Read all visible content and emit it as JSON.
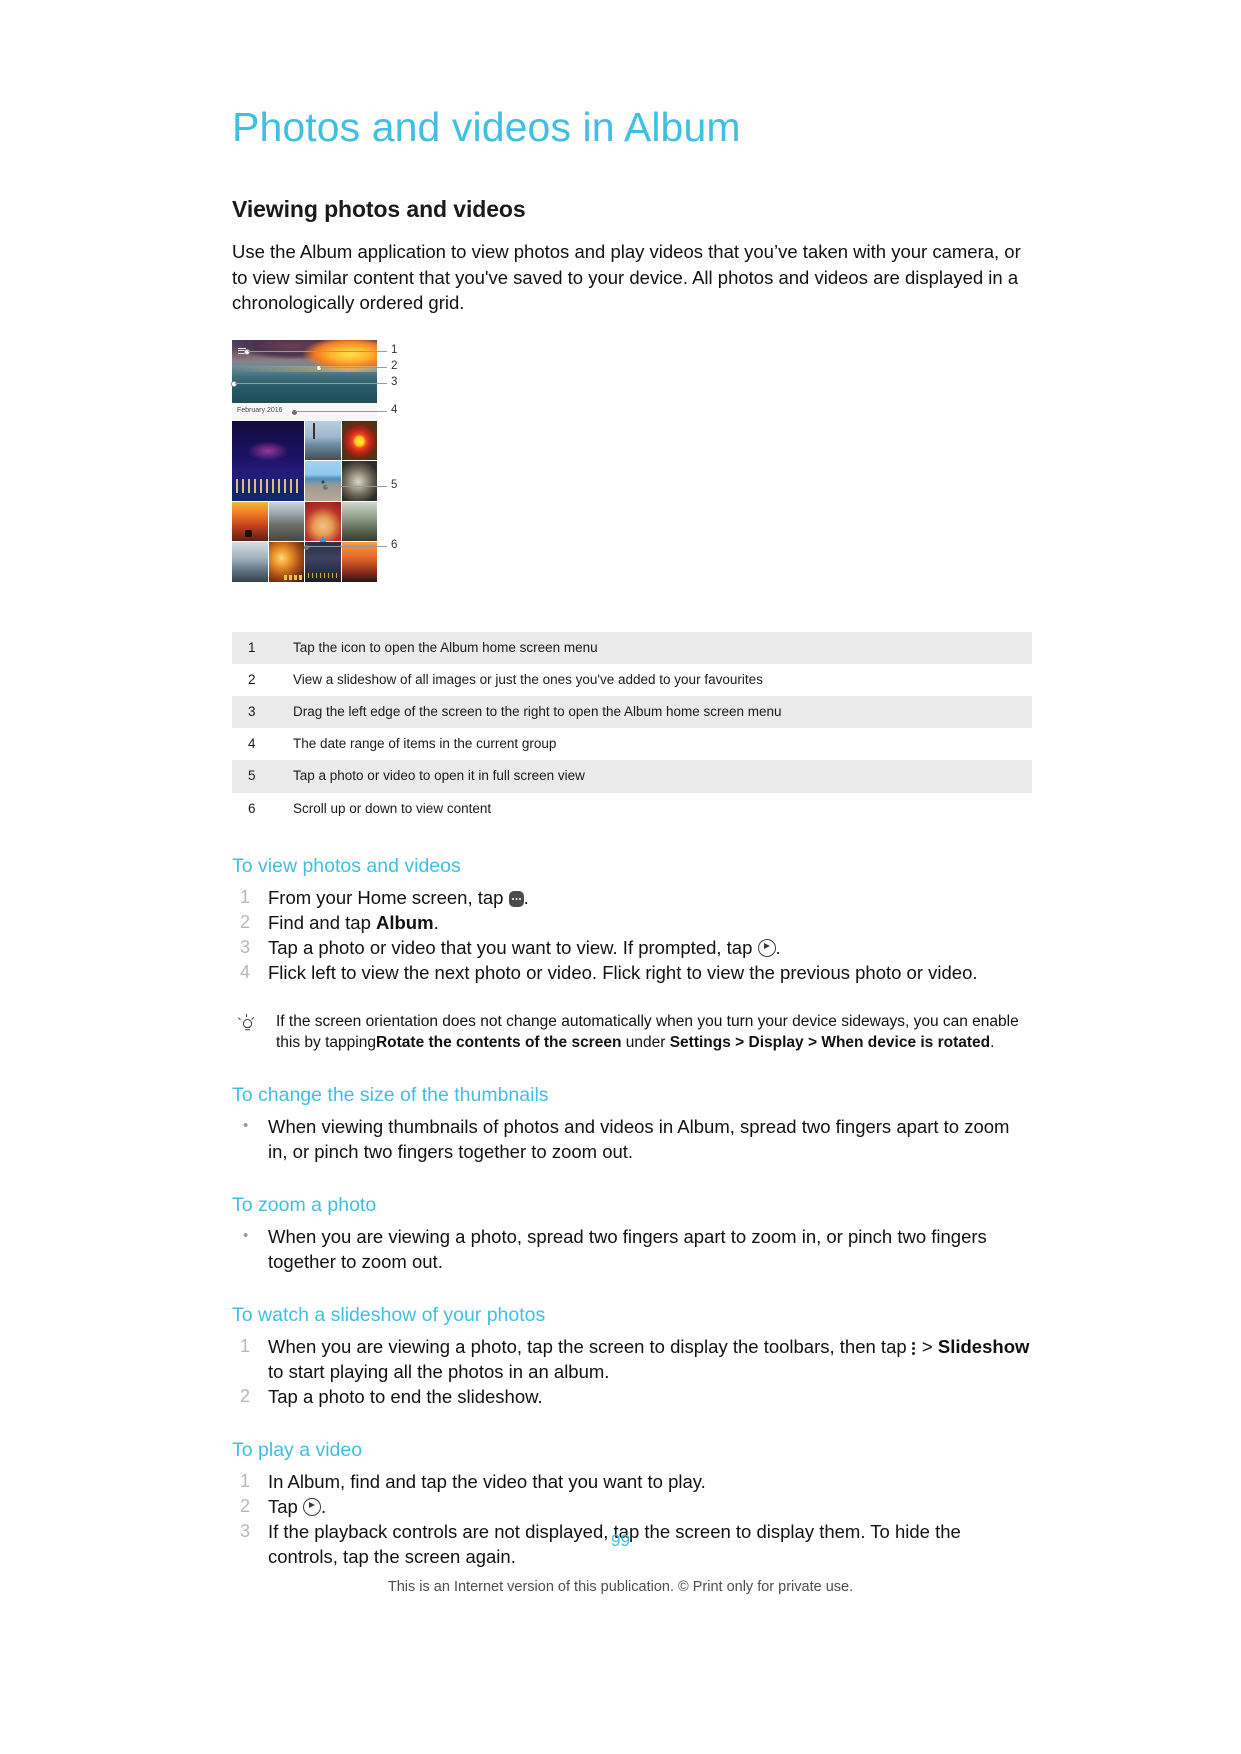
{
  "document": {
    "title": "Photos and videos in Album",
    "section_heading": "Viewing photos and videos",
    "intro": "Use the Album application to view photos and play videos that you’ve taken with your camera, or to view similar content that you've saved to your device. All photos and videos are displayed in a chronologically ordered grid.",
    "page_number": "99",
    "footer": "This is an Internet version of this publication. © Print only for private use.",
    "accent_color": "#41bfe3"
  },
  "figure": {
    "date_label": "February 2016",
    "callouts": [
      "1",
      "2",
      "3",
      "4",
      "5",
      "6"
    ]
  },
  "legend": {
    "rows": [
      {
        "num": "1",
        "text": "Tap the icon to open the Album home screen menu"
      },
      {
        "num": "2",
        "text": "View a slideshow of all images or just the ones you've added to your favourites"
      },
      {
        "num": "3",
        "text": "Drag the left edge of the screen to the right to open the Album home screen menu"
      },
      {
        "num": "4",
        "text": "The date range of items in the current group"
      },
      {
        "num": "5",
        "text": "Tap a photo or video to open it in full screen view"
      },
      {
        "num": "6",
        "text": "Scroll up or down to view content"
      }
    ]
  },
  "procedures": {
    "view_photos": {
      "heading": "To view photos and videos",
      "step1_pre": "From your Home screen, tap ",
      "step1_post": ".",
      "step2_pre": "Find and tap ",
      "step2_bold": "Album",
      "step2_post": ".",
      "step3_pre": "Tap a photo or video that you want to view. If prompted, tap ",
      "step3_post": ".",
      "step4": "Flick left to view the next photo or video. Flick right to view the previous photo or video."
    },
    "tip": {
      "part1": "If the screen orientation does not change automatically when you turn your device sideways, you can enable this by tapping",
      "bold1": "Rotate the contents of the screen",
      "part2": " under ",
      "bold2": "Settings > Display > When device is rotated",
      "part3": "."
    },
    "thumbnail_size": {
      "heading": "To change the size of the thumbnails",
      "bullet": "When viewing thumbnails of photos and videos in Album, spread two fingers apart to zoom in, or pinch two fingers together to zoom out."
    },
    "zoom_photo": {
      "heading": "To zoom a photo",
      "bullet": "When you are viewing a photo, spread two fingers apart to zoom in, or pinch two fingers together to zoom out."
    },
    "slideshow": {
      "heading": "To watch a slideshow of your photos",
      "step1_pre": "When you are viewing a photo, tap the screen to display the toolbars, then tap ",
      "step1_mid": " > ",
      "step1_bold": "Slideshow",
      "step1_post": " to start playing all the photos in an album.",
      "step2": "Tap a photo to end the slideshow."
    },
    "play_video": {
      "heading": "To play a video",
      "step1": "In Album, find and tap the video that you want to play.",
      "step2_pre": "Tap ",
      "step2_post": ".",
      "step3": "If the playback controls are not displayed, tap the screen to display them. To hide the controls, tap the screen again."
    }
  },
  "icons": {
    "app_drawer": "app-drawer-icon",
    "play": "play-icon",
    "kebab": "overflow-menu-icon",
    "tip_bulb": "lightbulb-icon"
  }
}
